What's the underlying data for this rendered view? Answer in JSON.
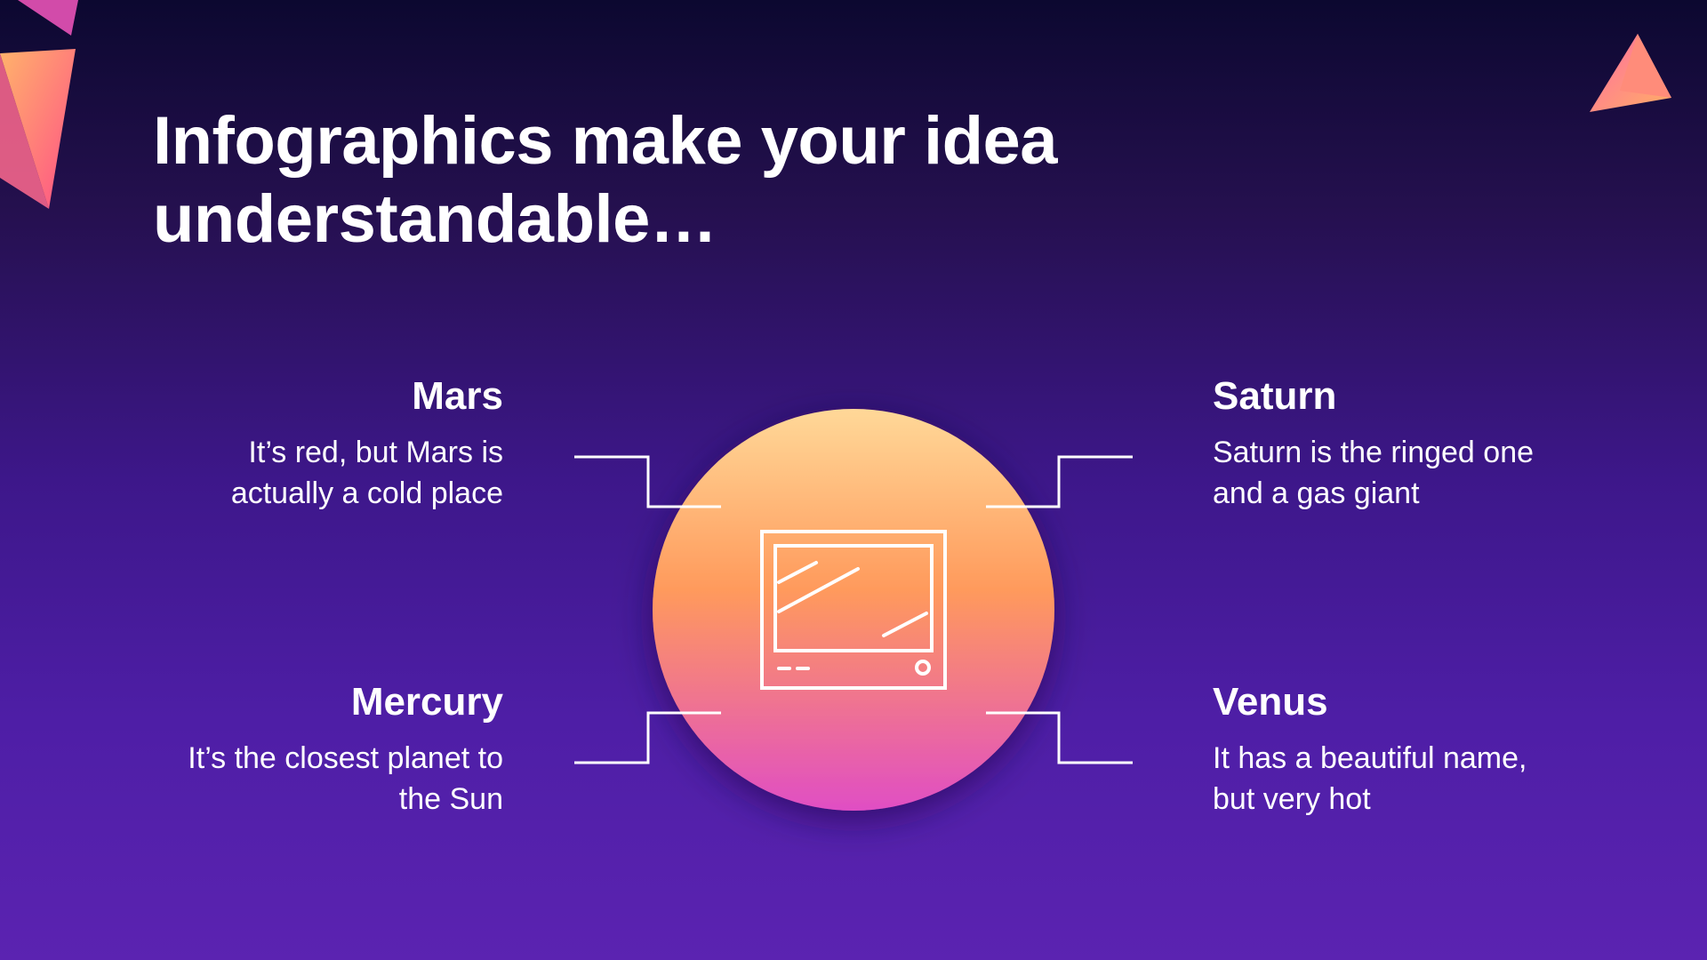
{
  "slide": {
    "title": "Infographics make your idea understandable…"
  },
  "items": {
    "mars": {
      "title": "Mars",
      "description": "It’s red, but Mars is actually a cold place"
    },
    "saturn": {
      "title": "Saturn",
      "description": "Saturn is the ringed one and a gas giant"
    },
    "mercury": {
      "title": "Mercury",
      "description": "It’s the closest planet to the Sun"
    },
    "venus": {
      "title": "Venus",
      "description": "It has a beautiful name, but very hot"
    }
  },
  "center": {
    "icon": "monitor-icon"
  },
  "colors": {
    "background_top": "#0c0830",
    "background_bottom": "#5b23b1",
    "circle_top": "#ffd898",
    "circle_middle": "#ff9a5c",
    "circle_bottom": "#e04ec4",
    "text": "#ffffff"
  }
}
